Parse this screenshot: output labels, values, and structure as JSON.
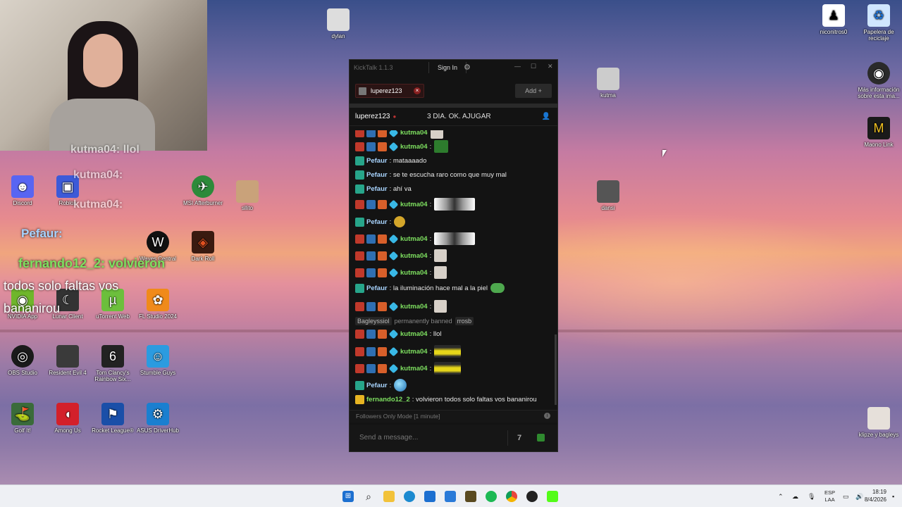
{
  "desktop": {
    "icons": [
      {
        "label": "dylan",
        "icon": "cat-photo-icon"
      },
      {
        "label": "niconitros0",
        "icon": "figure-icon"
      },
      {
        "label": "Papelera de reciclaje",
        "icon": "recycle-bin-icon"
      },
      {
        "label": "kutma",
        "icon": "cat-photo-icon"
      },
      {
        "label": "Más información sobre esta ima...",
        "icon": "info-icon"
      },
      {
        "label": "Maono Link",
        "icon": "maono-icon"
      },
      {
        "label": "dansi",
        "icon": "cat-photo-icon"
      },
      {
        "label": "klipze y bagleys",
        "icon": "photo-icon"
      },
      {
        "label": "sllito",
        "icon": "cat-photo-icon"
      },
      {
        "label": "MSI Afterburner",
        "icon": "afterburner-icon"
      },
      {
        "label": "Dark Roll",
        "icon": "dark-roll-icon"
      },
      {
        "label": "Waves Central",
        "icon": "waves-icon"
      },
      {
        "label": "Lunar Client",
        "icon": "lunar-icon"
      },
      {
        "label": "uTorrent Web",
        "icon": "utorrent-icon"
      },
      {
        "label": "FL Studio 2024",
        "icon": "fl-studio-icon"
      },
      {
        "label": "OBS Studio",
        "icon": "obs-icon"
      },
      {
        "label": "Resident Evil 4",
        "icon": "re4-icon"
      },
      {
        "label": "Tom Clancy's Rainbow Six...",
        "icon": "r6-icon"
      },
      {
        "label": "Stumble Guys",
        "icon": "stumble-icon"
      },
      {
        "label": "Golf It!",
        "icon": "golf-icon"
      },
      {
        "label": "Among Us",
        "icon": "among-us-icon"
      },
      {
        "label": "Rocket League®",
        "icon": "rocket-league-icon"
      },
      {
        "label": "ASUS DriverHub",
        "icon": "asus-icon"
      },
      {
        "label": "NVIDIA App",
        "icon": "nvidia-icon"
      },
      {
        "label": "Discord",
        "icon": "discord-icon"
      },
      {
        "label": "Roblox",
        "icon": "roblox-icon"
      }
    ],
    "overlay": {
      "line1": "fernando12_2: volvieron",
      "line2": "todos solo faltas vos",
      "line3": "bananirou",
      "ghost1": "kutma04: llol",
      "ghost2": "kutma04:",
      "ghost3": "kutma04:",
      "ghost4": "Pefaur:"
    }
  },
  "kicktalk": {
    "title": "KickTalk 1.1.3",
    "sign_in": "Sign In",
    "gear": "⚙",
    "win_min": "—",
    "win_max": "☐",
    "win_close": "✕",
    "tab_name": "luperez123",
    "add_label": "Add +",
    "channel": "luperez123",
    "stream_title": "3 DIA. OK. AJUGAR",
    "messages": [
      {
        "user": "kutma04",
        "text": ":",
        "emote": "grn"
      },
      {
        "user": "Pefaur",
        "text": ": mataaaado"
      },
      {
        "user": "Pefaur",
        "text": ": se te escucha raro como que muy mal"
      },
      {
        "user": "Pefaur",
        "text": ": ahí va"
      },
      {
        "user": "kutma04",
        "text": ":",
        "emote": "cap"
      },
      {
        "user": "Pefaur",
        "text": ":",
        "emote": "pen"
      },
      {
        "user": "kutma04",
        "text": ":",
        "emote": "cap"
      },
      {
        "user": "kutma04",
        "text": ":",
        "emote": "sm"
      },
      {
        "user": "kutma04",
        "text": ":",
        "emote": "sm"
      },
      {
        "user": "Pefaur",
        "text": ": la iluminación hace mal a la piel",
        "emote": "frog"
      },
      {
        "user": "kutma04",
        "text": ":",
        "emote": "sm"
      },
      {
        "user": "kutma04",
        "text": ": llol"
      },
      {
        "user": "kutma04",
        "text": ":",
        "emote": "car"
      },
      {
        "user": "kutma04",
        "text": ":",
        "emote": "car"
      },
      {
        "user": "Pefaur",
        "text": ":",
        "emote": "globe"
      },
      {
        "user": "fernando12_2",
        "text": ": volvieron todos solo faltas vos bananirou"
      }
    ],
    "ban": {
      "user": "Bagleyssiol",
      "text": "permanently banned",
      "by": "rrosb"
    },
    "followers_mode": "Followers Only Mode [1 minute]",
    "input_placeholder": "Send a message...",
    "info_icon": "i",
    "emote_btn": "7tv"
  },
  "taskbar": {
    "lang": "ESP",
    "lang2": "LAA",
    "time": "18:19",
    "date": "8/4/2026"
  }
}
